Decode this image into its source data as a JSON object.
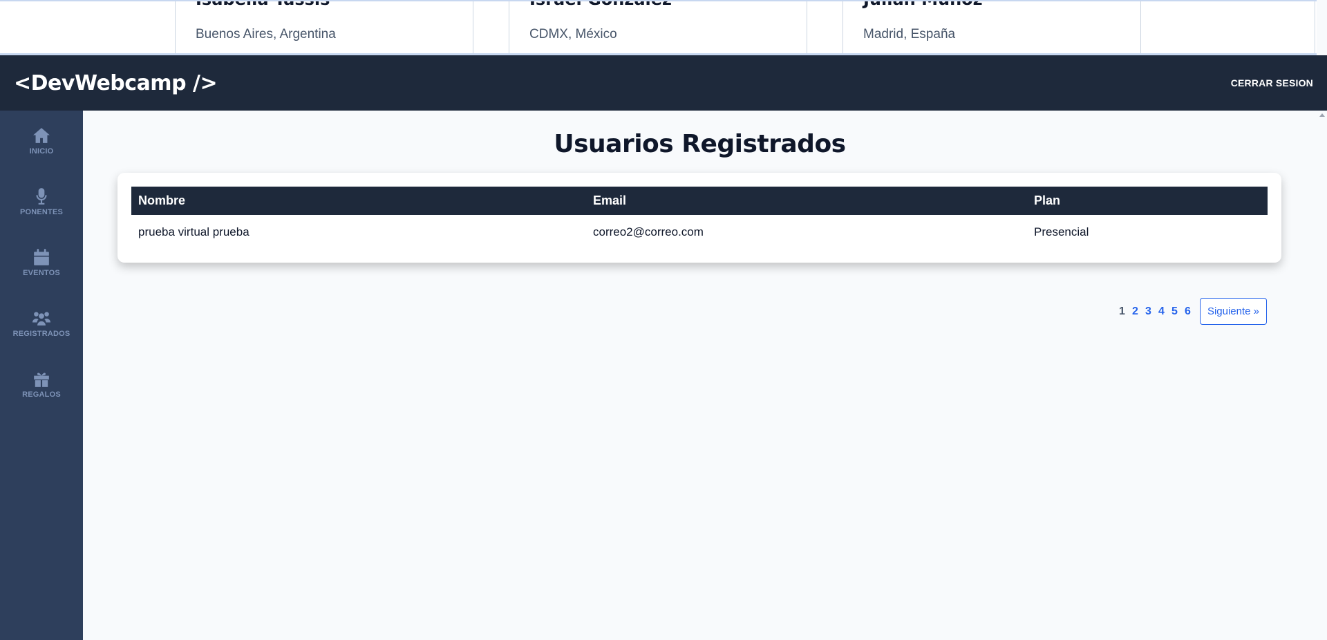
{
  "speakers": [
    {
      "name": "Isabella Tassis",
      "location": "Buenos Aires, Argentina"
    },
    {
      "name": "Israel González",
      "location": "CDMX, México"
    },
    {
      "name": "Julián Muñoz",
      "location": "Madrid, España"
    }
  ],
  "header": {
    "logo": "<DevWebcamp />",
    "logout": "CERRAR SESION"
  },
  "sidebar": {
    "items": [
      {
        "label": "INICIO",
        "icon": "home-icon"
      },
      {
        "label": "PONENTES",
        "icon": "microphone-icon"
      },
      {
        "label": "EVENTOS",
        "icon": "calendar-icon"
      },
      {
        "label": "REGISTRADOS",
        "icon": "users-icon"
      },
      {
        "label": "REGALOS",
        "icon": "gift-icon"
      }
    ]
  },
  "main": {
    "title": "Usuarios Registrados",
    "table": {
      "headers": [
        "Nombre",
        "Email",
        "Plan"
      ],
      "rows": [
        [
          "prueba virtual prueba",
          "correo2@correo.com",
          "Presencial"
        ]
      ]
    },
    "pagination": {
      "pages": [
        "1",
        "2",
        "3",
        "4",
        "5",
        "6"
      ],
      "current": "1",
      "next": "Siguiente »"
    }
  },
  "colors": {
    "header_bg": "#1e293b",
    "sidebar_bg": "#2e3f5c",
    "sidebar_fg": "#7e93b7",
    "link": "#2563eb"
  }
}
